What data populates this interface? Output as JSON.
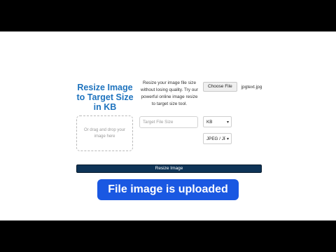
{
  "tool": {
    "title": "Resize Image to Target Size in KB",
    "description": "Resize your image file size without losing quality. Try our powerful online image resize to target size tool.",
    "file_input": {
      "button_label": "Choose File",
      "file_name": "jpgtext.jpg"
    },
    "dropzone_text": "Or drag and drop your image here",
    "target_size": {
      "placeholder": "Target File Size",
      "value": ""
    },
    "unit_select": {
      "selected": "KB"
    },
    "format_select": {
      "selected": "JPEG / JP"
    },
    "resize_button_label": "Resize Image"
  },
  "caption": "File image is uploaded",
  "colors": {
    "title": "#1e73be",
    "button_bg": "#0e3457",
    "caption_bg": "#1a58e2",
    "letterbox": "#000000"
  }
}
